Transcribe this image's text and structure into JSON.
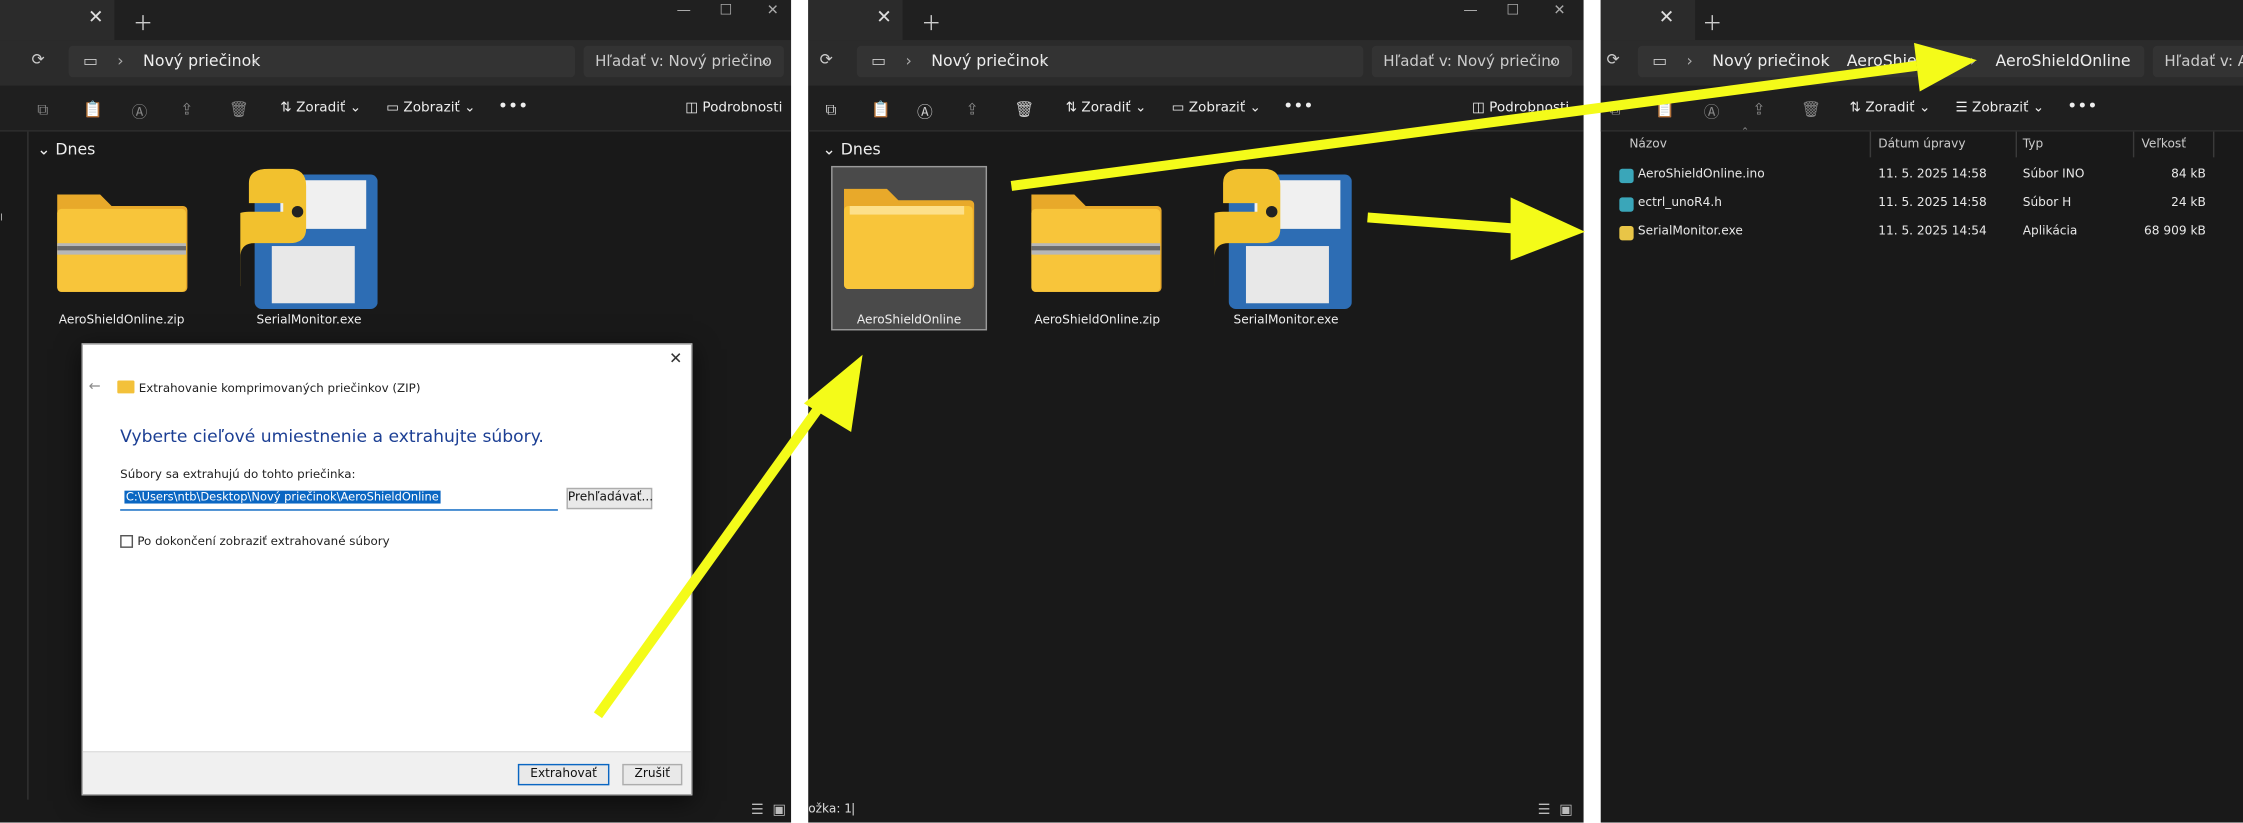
{
  "left": {
    "address": {
      "folder": "Nový priečinok",
      "search": "Hľadať v: Nový priečino"
    },
    "toolbar": {
      "sort": "Zoradiť",
      "view": "Zobraziť",
      "details": "Podrobnosti"
    },
    "group": "Dnes",
    "files": [
      {
        "name": "AeroShieldOnline.zip"
      },
      {
        "name": "SerialMonitor.exe"
      }
    ],
    "side_letter": "I"
  },
  "dialog": {
    "title": "Extrahovanie komprimovaných priečinkov (ZIP)",
    "heading": "Vyberte cieľové umiestnenie a extrahujte súbory.",
    "field_label": "Súbory sa extrahujú do tohto priečinka:",
    "path_value": "C:\\Users\\ntb\\Desktop\\Nový priečinok\\AeroShieldOnline",
    "browse_label": "Prehľadávať...",
    "checkbox_label": "Po dokončení zobraziť extrahované súbory",
    "extract_label": "Extrahovať",
    "cancel_label": "Zrušiť"
  },
  "middle": {
    "address": {
      "folder": "Nový priečinok",
      "search": "Hľadať v: Nový priečino"
    },
    "toolbar": {
      "sort": "Zoradiť",
      "view": "Zobraziť",
      "details": "Podrobnosti"
    },
    "group": "Dnes",
    "files": [
      {
        "name": "AeroShieldOnline"
      },
      {
        "name": "AeroShieldOnline.zip"
      },
      {
        "name": "SerialMonitor.exe"
      }
    ],
    "status": "ožka: 1"
  },
  "right": {
    "address": {
      "crumb1": "Nový priečinok",
      "crumb2": "AeroShie",
      "crumb3": "AeroShieldOnline",
      "search": "Hľadať v: Ae"
    },
    "toolbar": {
      "sort": "Zoradiť",
      "view": "Zobraziť"
    },
    "columns": {
      "name": "Názov",
      "date": "Dátum úpravy",
      "type": "Typ",
      "size": "Veľkosť"
    },
    "rows": [
      {
        "name": "AeroShieldOnline.ino",
        "date": "11. 5. 2025 14:58",
        "type": "Súbor INO",
        "size": "84 kB",
        "color": "#3aa6b9"
      },
      {
        "name": "ectrl_unoR4.h",
        "date": "11. 5. 2025 14:58",
        "type": "Súbor H",
        "size": "24 kB",
        "color": "#3aa6b9"
      },
      {
        "name": "SerialMonitor.exe",
        "date": "11. 5. 2025 14:54",
        "type": "Aplikácia",
        "size": "68 909 kB",
        "color": "#e8c547"
      }
    ]
  },
  "colors": {
    "arrow": "#f4fb19",
    "folder": "#f8c53a",
    "dialog_heading": "#1c3f94",
    "selection": "#0a66c2"
  }
}
